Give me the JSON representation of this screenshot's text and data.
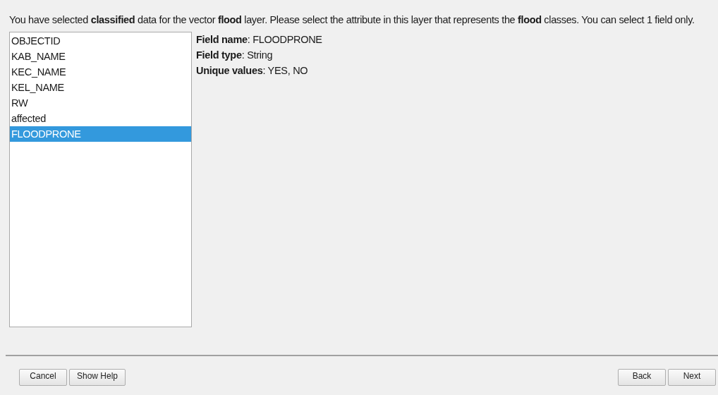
{
  "instruction": "You have selected **classified** data for the vector **flood** layer. Please select the attribute in this layer that represents the **flood** classes. You can select 1 field only.",
  "fields": [
    {
      "label": "OBJECTID",
      "selected": false
    },
    {
      "label": "KAB_NAME",
      "selected": false
    },
    {
      "label": "KEC_NAME",
      "selected": false
    },
    {
      "label": "KEL_NAME",
      "selected": false
    },
    {
      "label": "RW",
      "selected": false
    },
    {
      "label": "affected",
      "selected": false
    },
    {
      "label": "FLOODPRONE",
      "selected": true
    }
  ],
  "details": [
    "**Field name**: FLOODPRONE",
    "**Field type**: String",
    "**Unique values**: YES, NO"
  ],
  "left_buttons": [
    "Cancel",
    "Show Help"
  ],
  "right_buttons": [
    "Back",
    "Next"
  ]
}
